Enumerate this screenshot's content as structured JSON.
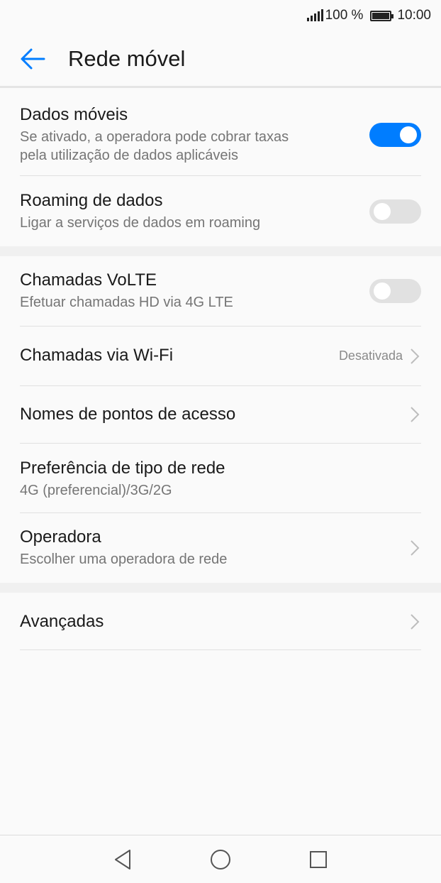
{
  "status_bar": {
    "battery_text": "100 %",
    "time": "10:00"
  },
  "header": {
    "title": "Rede móvel"
  },
  "colors": {
    "accent": "#007dff",
    "toggle_off": "#e1e1e1"
  },
  "settings": {
    "dados_moveis": {
      "title": "Dados móveis",
      "subtitle_line1": "Se ativado, a operadora pode cobrar taxas",
      "subtitle_line2": "pela utilização de dados aplicáveis",
      "enabled": true
    },
    "roaming": {
      "title": "Roaming de dados",
      "subtitle": "Ligar a serviços de dados em roaming",
      "enabled": false
    },
    "volte": {
      "title": "Chamadas VoLTE",
      "subtitle": "Efetuar chamadas HD via 4G LTE",
      "enabled": false
    },
    "wifi_calling": {
      "title": "Chamadas via Wi-Fi",
      "value": "Desativada"
    },
    "apn": {
      "title": "Nomes de pontos de acesso"
    },
    "network_type": {
      "title": "Preferência de tipo de rede",
      "subtitle": "4G (preferencial)/3G/2G"
    },
    "operator": {
      "title": "Operadora",
      "subtitle": "Escolher uma operadora de rede"
    },
    "advanced": {
      "title": "Avançadas"
    }
  },
  "nav_bar": {
    "icons": [
      "back-triangle-icon",
      "home-circle-icon",
      "recents-square-icon"
    ]
  }
}
